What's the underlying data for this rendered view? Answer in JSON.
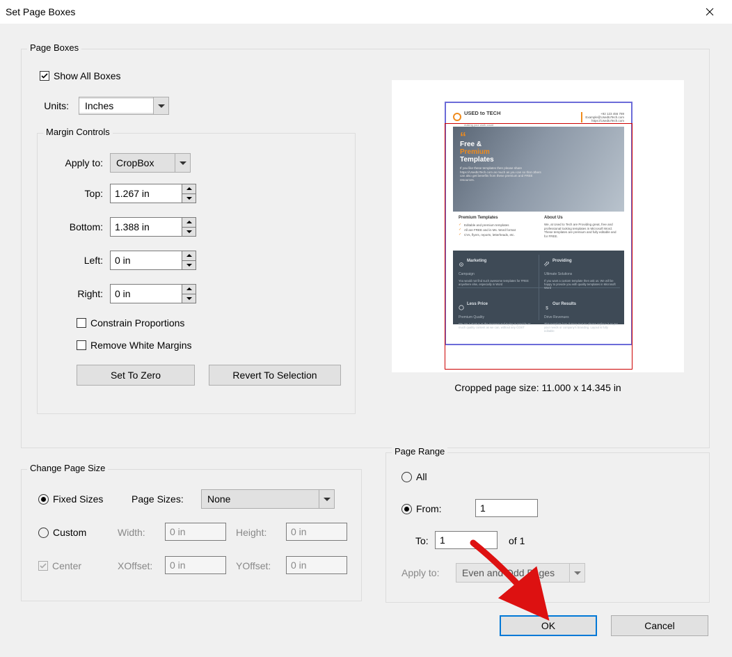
{
  "window": {
    "title": "Set Page Boxes"
  },
  "page_boxes": {
    "group_label": "Page Boxes",
    "show_all_boxes_label": "Show All Boxes",
    "show_all_boxes_checked": true,
    "units_label": "Units:",
    "units_value": "Inches"
  },
  "margin_controls": {
    "group_label": "Margin Controls",
    "apply_to_label": "Apply to:",
    "apply_to_value": "CropBox",
    "top_label": "Top:",
    "top_value": "1.267 in",
    "bottom_label": "Bottom:",
    "bottom_value": "1.388 in",
    "left_label": "Left:",
    "left_value": "0 in",
    "right_label": "Right:",
    "right_value": "0 in",
    "constrain_label": "Constrain Proportions",
    "constrain_checked": false,
    "remove_white_label": "Remove White Margins",
    "remove_white_checked": false,
    "set_to_zero_label": "Set To Zero",
    "revert_label": "Revert To Selection"
  },
  "preview": {
    "cropped_size_text": "Cropped page size: 11.000 x 14.345 in",
    "brand": "USED to TECH",
    "brand_sub": "making your work count",
    "contact1": "+92 123 456 789",
    "contact2": "Example@UsedtoTech.com",
    "contact3": "https://UsedtoTech.com",
    "hero_l1": "Free &",
    "hero_l2": "Premium",
    "hero_l3": "Templates",
    "hero_para": "If you like these templates then please share https://UsedtoTech.com as much as you can so that others can also get benefits from these premium and FREE resources.",
    "mid_h1": "Premium Templates",
    "mid_b1": "Editable and premium templates",
    "mid_b2": "All are FREE and in Ms. Word format",
    "mid_b3": "CVs, flyers, reports, letterheads, etc.",
    "mid_h2": "About Us",
    "mid_about": "We, at Used to Tech are Providing great, free and professional looking templates in Microsoft Word. These templates are premium and fully editable and for FREE.",
    "cell1_t": "Marketing",
    "cell1_s": "Campaign",
    "cell1_p": "You would not find such awesome templates for FREE anywhere else, especially in Word",
    "cell2_t": "Providing",
    "cell2_s": "Ultimate Solutions",
    "cell2_p": "If you want a custom template then ask us. We will be happy to provide you with quality templates in Microsoft Word",
    "cell3_t": "Less Price",
    "cell3_s": "Premium Quality",
    "cell3_p": "We are a startup at the moment and trying to provide as much quality content as we can, without any COST",
    "cell4_t": "Our Results",
    "cell4_s": "Drive Revenues",
    "cell4_p": "This template has dummy text so please replace it as per your needs or company's branding. Layout is fully editable"
  },
  "change_page_size": {
    "group_label": "Change Page Size",
    "fixed_sizes_label": "Fixed Sizes",
    "custom_label": "Custom",
    "mode": "fixed",
    "page_sizes_label": "Page Sizes:",
    "page_sizes_value": "None",
    "width_label": "Width:",
    "width_value": "0 in",
    "height_label": "Height:",
    "height_value": "0 in",
    "center_label": "Center",
    "center_checked": true,
    "xoffset_label": "XOffset:",
    "xoffset_value": "0 in",
    "yoffset_label": "YOffset:",
    "yoffset_value": "0 in"
  },
  "page_range": {
    "group_label": "Page Range",
    "all_label": "All",
    "from_label": "From:",
    "from_value": "1",
    "to_label": "To:",
    "to_value": "1",
    "of_label": "of 1",
    "mode": "from",
    "apply_to_label": "Apply to:",
    "apply_to_value": "Even and Odd Pages"
  },
  "buttons": {
    "ok": "OK",
    "cancel": "Cancel"
  }
}
